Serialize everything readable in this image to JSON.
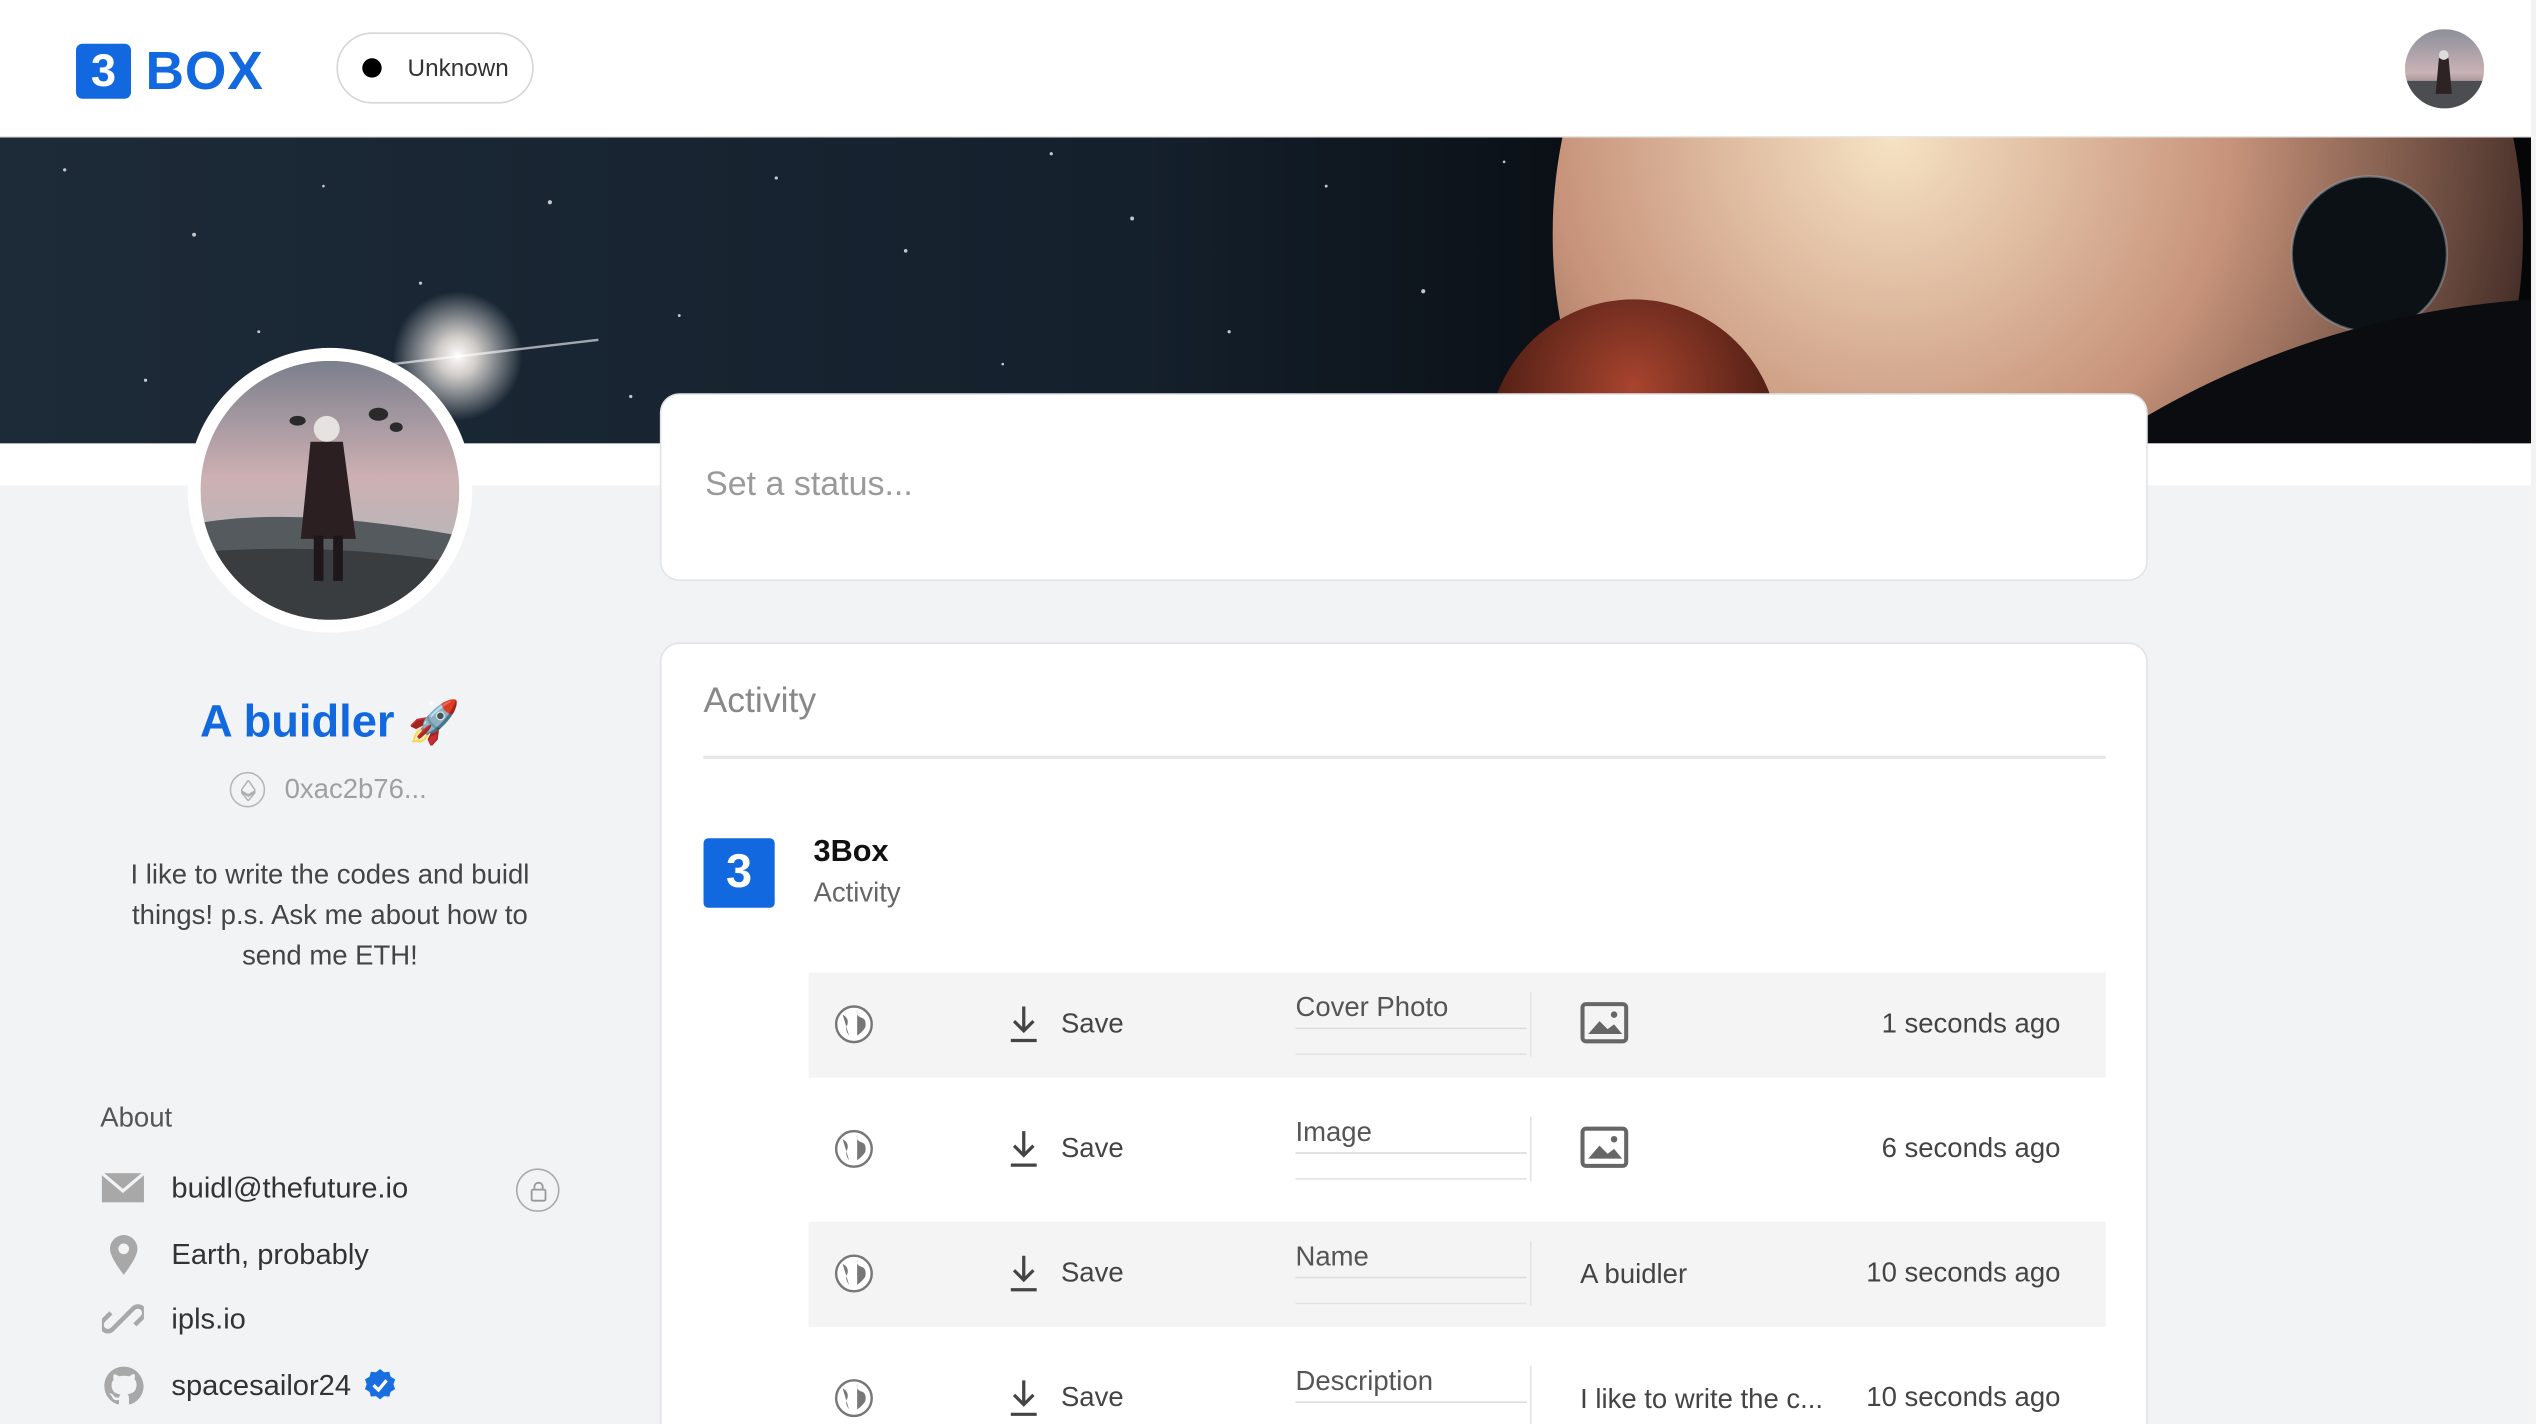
{
  "brand": {
    "logo_char": "3",
    "logo_text": "BOX",
    "accent": "#1168df"
  },
  "network": {
    "label": "Unknown",
    "dot_color": "#000000"
  },
  "profile": {
    "name": "A buidler",
    "emoji": "🚀",
    "address": "0xac2b76...",
    "bio": "I like to write the codes and buidl things! p.s. Ask me about how to send me ETH!"
  },
  "about": {
    "title": "About",
    "items": [
      {
        "icon": "mail-icon",
        "label": "buidl@thefuture.io",
        "private": true
      },
      {
        "icon": "location-pin-icon",
        "label": "Earth, probably"
      },
      {
        "icon": "link-icon",
        "label": "ipls.io"
      },
      {
        "icon": "github-icon",
        "label": "spacesailor24",
        "verified": true
      }
    ]
  },
  "status": {
    "placeholder": "Set a status..."
  },
  "activity": {
    "title": "Activity",
    "app": {
      "badge": "3",
      "name": "3Box",
      "subtitle": "Activity"
    },
    "rows": [
      {
        "action": "Save",
        "field": "Cover Photo",
        "value_type": "image",
        "value": "",
        "time": "1 seconds ago"
      },
      {
        "action": "Save",
        "field": "Image",
        "value_type": "image",
        "value": "",
        "time": "6 seconds ago"
      },
      {
        "action": "Save",
        "field": "Name",
        "value_type": "text",
        "value": "A buidler",
        "time": "10 seconds ago"
      },
      {
        "action": "Save",
        "field": "Description",
        "value_type": "text",
        "value": "I like to write the c...",
        "time": "10 seconds ago"
      }
    ]
  }
}
